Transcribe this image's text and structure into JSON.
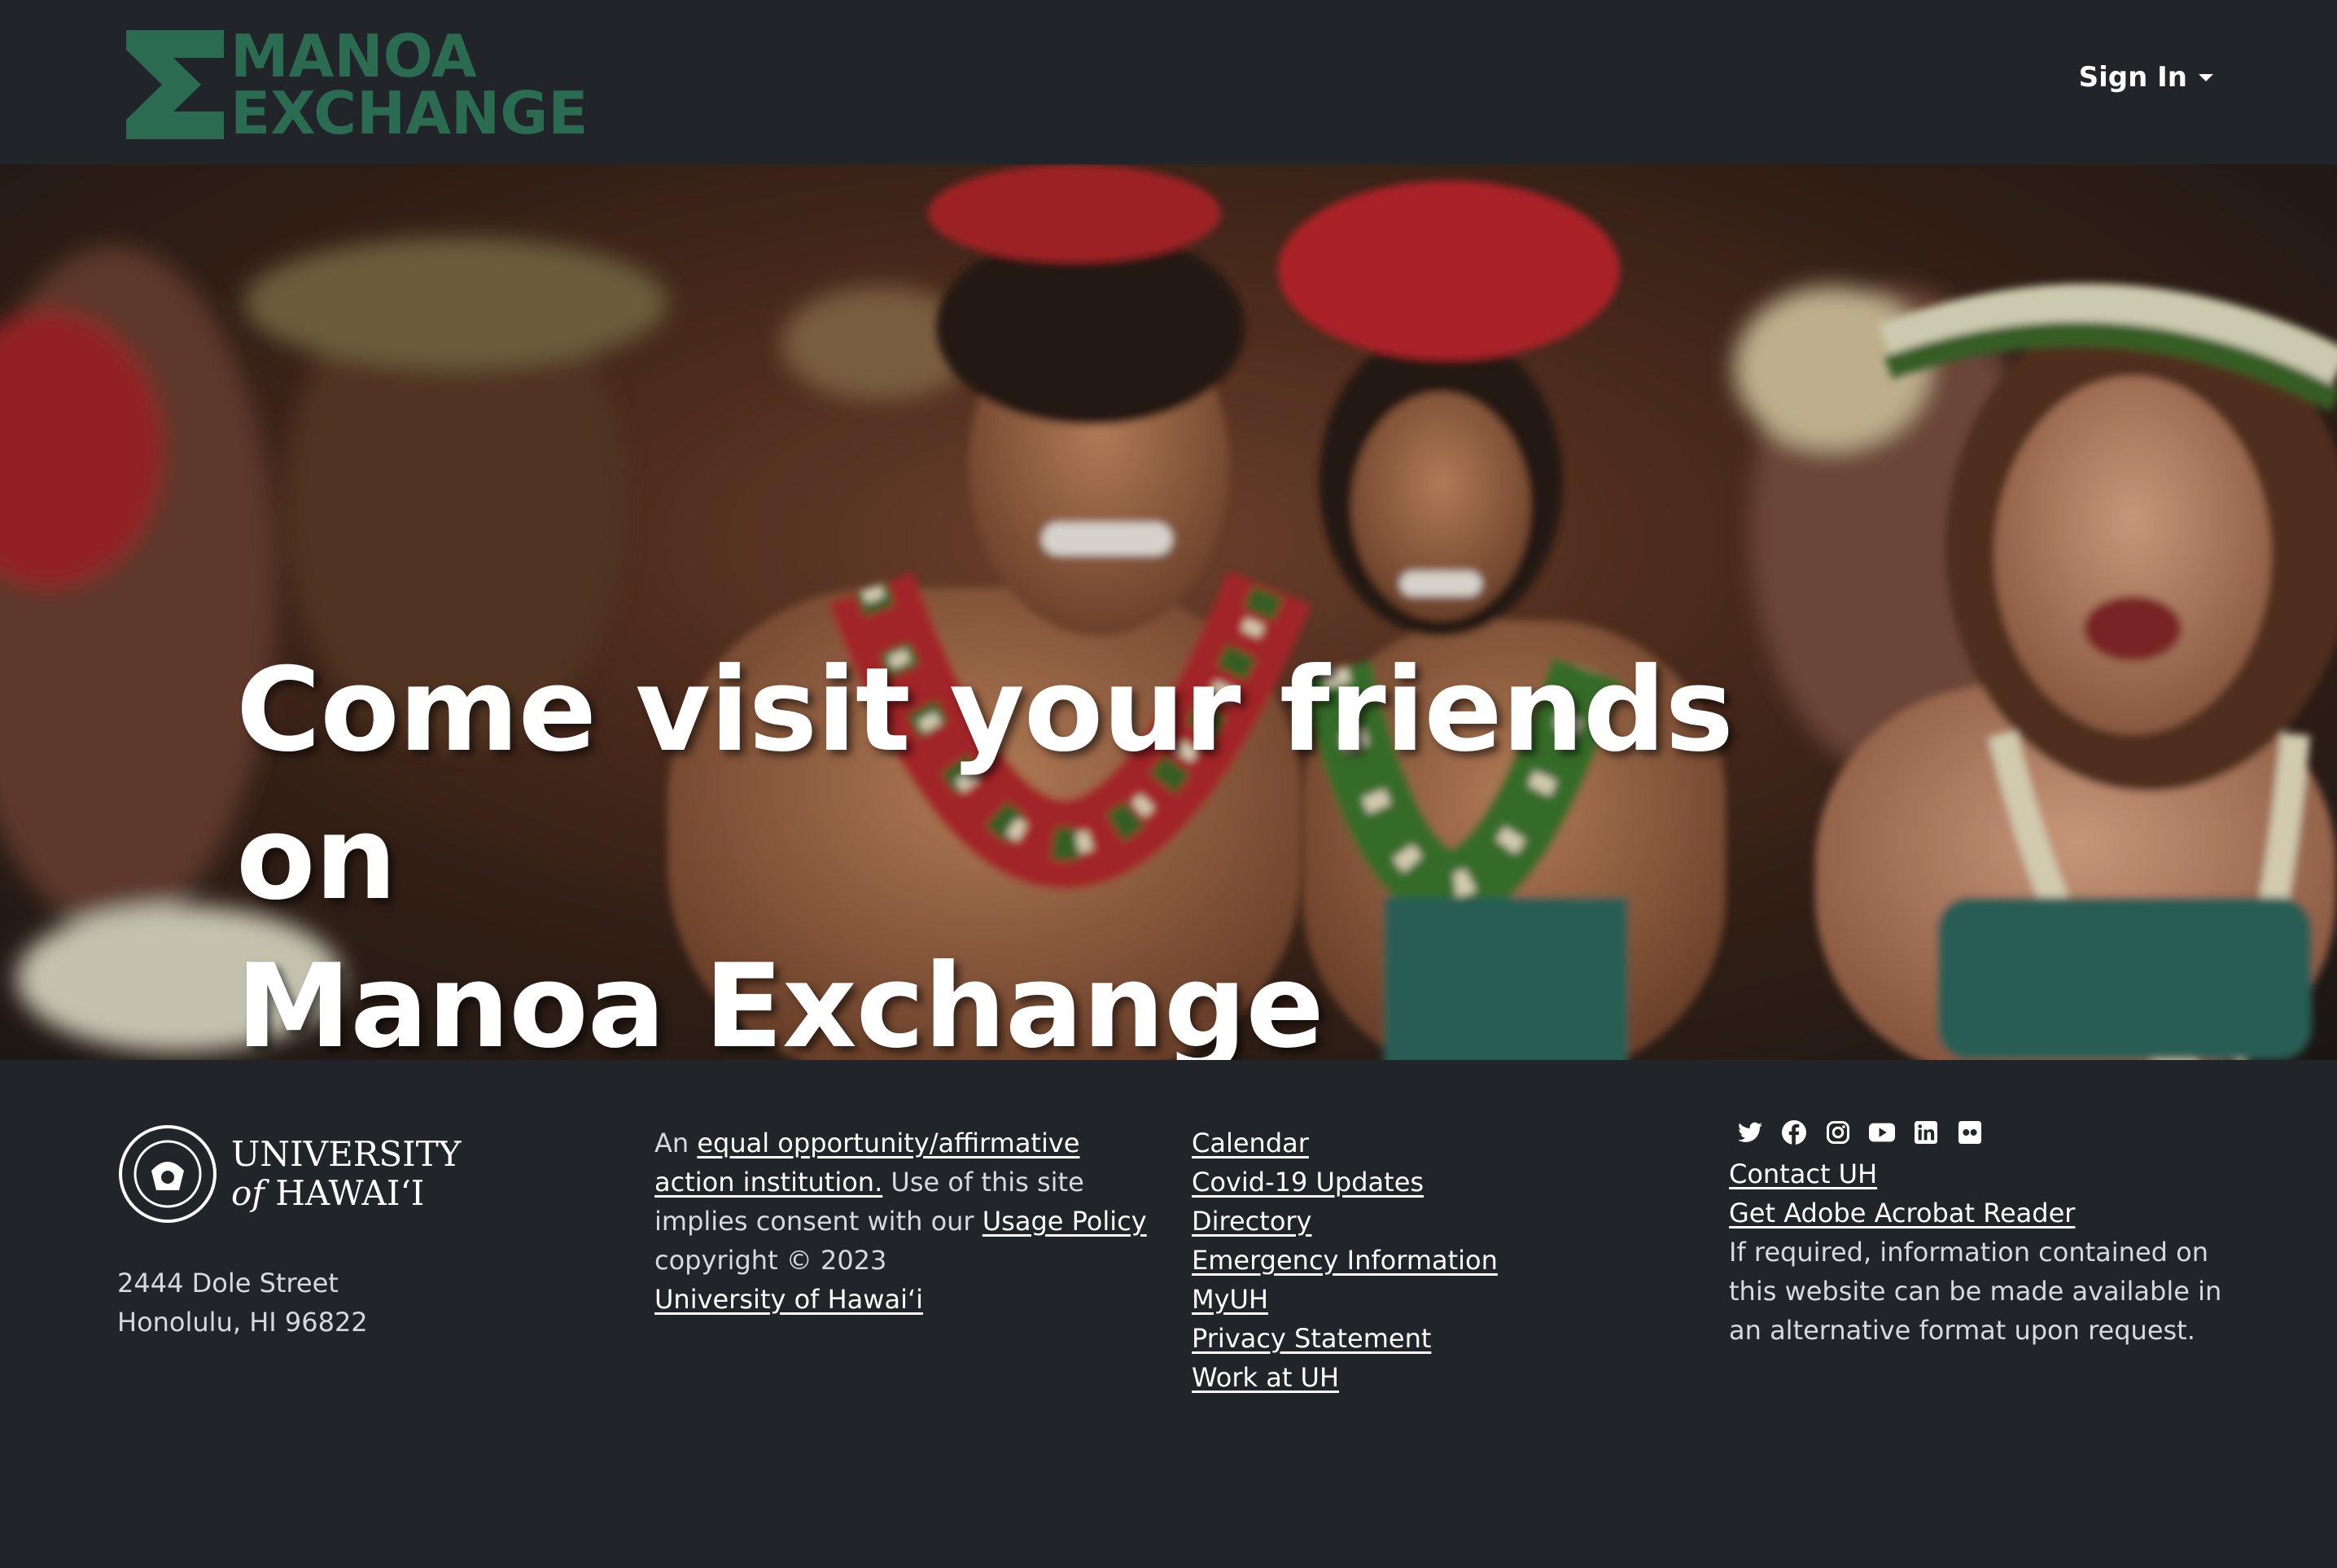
{
  "navbar": {
    "logo_line1": "MANOA",
    "logo_line2": "EXCHANGE",
    "signin_label": "Sign In"
  },
  "hero": {
    "title_line1": "Come visit your friends on",
    "title_line2": "Manoa Exchange"
  },
  "footer": {
    "uh_name_line1": "UNIVERSITY",
    "uh_name_of": "of",
    "uh_name_line2": "HAWAI‘I",
    "address_line1": "2444 Dole Street",
    "address_line2": "Honolulu, HI 96822",
    "eo_prefix": "An ",
    "eo_link": "equal opportunity/affirmative action institution.",
    "eo_middle": " Use of this site implies consent with our ",
    "usage_link": "Usage Policy",
    "copyright": "copyright © 2023",
    "uh_link": "University of Hawaiʻi",
    "links": [
      "Calendar",
      "Covid-19 Updates",
      "Directory",
      "Emergency Information",
      "MyUH",
      "Privacy Statement",
      "Work at UH"
    ],
    "social_icons": [
      "twitter-icon",
      "facebook-icon",
      "instagram-icon",
      "youtube-icon",
      "linkedin-icon",
      "flickr-icon"
    ],
    "contact_link": "Contact UH",
    "acrobat_link": "Get Adobe Acrobat Reader",
    "accessibility_note": "If required, information contained on this website can be made available in an alternative format upon request."
  },
  "colors": {
    "background": "#212529",
    "logo_green": "#2a6b52",
    "text_light": "#d7d9dc"
  }
}
